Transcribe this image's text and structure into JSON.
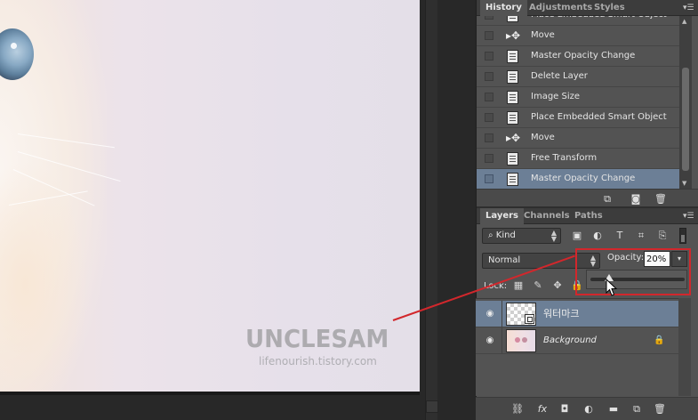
{
  "history_panel": {
    "tabs": [
      "History",
      "Adjustments",
      "Styles"
    ],
    "items": [
      {
        "label": "Place Embedded Smart Object",
        "icon": "document-icon"
      },
      {
        "label": "Move",
        "icon": "move-icon"
      },
      {
        "label": "Master Opacity Change",
        "icon": "document-icon"
      },
      {
        "label": "Delete Layer",
        "icon": "document-icon"
      },
      {
        "label": "Image Size",
        "icon": "image-size-icon"
      },
      {
        "label": "Place Embedded Smart Object",
        "icon": "document-icon"
      },
      {
        "label": "Move",
        "icon": "move-icon"
      },
      {
        "label": "Free Transform",
        "icon": "document-icon"
      },
      {
        "label": "Master Opacity Change",
        "icon": "document-icon"
      }
    ],
    "selected_index": 8
  },
  "layers_panel": {
    "tabs": [
      "Layers",
      "Channels",
      "Paths"
    ],
    "filter_kind": "Kind",
    "blend_mode": "Normal",
    "opacity_label": "Opacity:",
    "opacity_value": "20%",
    "opacity_fraction": 0.2,
    "lock_label": "Lock:",
    "layers": [
      {
        "name": "워터마크",
        "type": "smart-object",
        "visible": true,
        "selected": true
      },
      {
        "name": "Background",
        "type": "image",
        "visible": true,
        "locked": true
      }
    ]
  },
  "canvas": {
    "watermark_title": "UNCLESAM",
    "watermark_url": "lifenourish.tistory.com"
  },
  "colors": {
    "annotation": "#d2272c",
    "selection": "#6c7f96",
    "panel_bg": "#535353"
  }
}
